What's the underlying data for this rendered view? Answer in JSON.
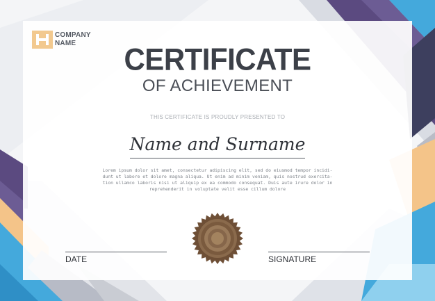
{
  "logo": {
    "line1": "COMPANY",
    "line2": "NAME",
    "accent": "#f2c98f"
  },
  "certificate": {
    "title": "CERTIFICATE",
    "subtitle": "OF ACHIEVEMENT",
    "presented_to": "THIS CERTIFICATE IS PROUDLY PRESENTED TO",
    "recipient": "Name and Surname",
    "body_lines": [
      "Lorem ipsum dolor sit amet, consectetur adipiscing elit, sed do eiusmod tempor incidi-",
      "dunt ut labore et dolore magna aliqua. Ut enim ad minim veniam, quis nostrud exercita-",
      "tion ullamco laboris nisi ut aliquip ex ea commodo consequat. Duis aute irure dolor in",
      "reprehenderit in voluptate velit esse cillum dolore"
    ]
  },
  "footer": {
    "date_label": "DATE",
    "signature_label": "SIGNATURE"
  },
  "colors": {
    "purple": "#5b4a80",
    "navy": "#3d3f5e",
    "blue": "#44a9dc",
    "light_blue": "#8fd0ee",
    "peach": "#f4c489",
    "gray": "#c9ccd3",
    "seal": "#7a5a3e",
    "text_dark": "#3c4048"
  }
}
